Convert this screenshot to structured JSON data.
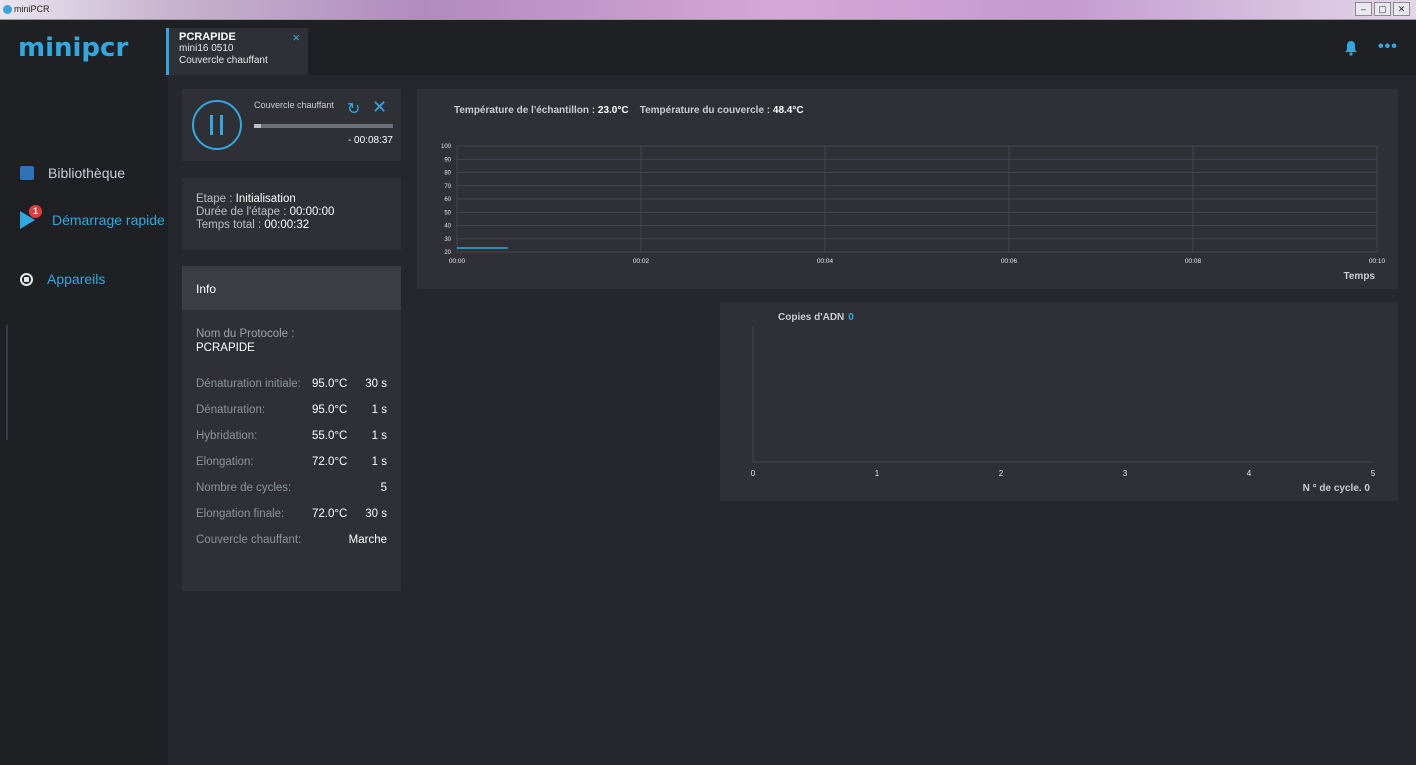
{
  "window": {
    "title": "miniPCR",
    "buttons": [
      "–",
      "▢",
      "✕"
    ]
  },
  "header": {
    "logo": "minipcr",
    "tab": {
      "name": "PCRAPIDE",
      "device": "mini16 0510",
      "status": "Couvercle chauffant",
      "close": "×"
    },
    "menu_dots": "•••"
  },
  "sidebar": {
    "items": [
      {
        "label": "Bibliothèque",
        "icon": "book-icon"
      },
      {
        "label": "Démarrage rapide",
        "icon": "play-icon",
        "badge": "1"
      },
      {
        "label": "Appareils",
        "icon": "device-icon"
      }
    ]
  },
  "run": {
    "label": "Couvercle chauffant",
    "refresh": "↻",
    "close": "✕",
    "remaining": "- 00:08:37",
    "progress": 0.05
  },
  "step": {
    "etape_label": "Etape : ",
    "etape_value": "Initialisation",
    "duree_label": "Durée de l'étape : ",
    "duree_value": "00:00:00",
    "total_label": "Temps total : ",
    "total_value": "00:00:32"
  },
  "info": {
    "header": "Info",
    "protocol_label": "Nom du Protocole :",
    "protocol_name": "PCRAPIDE",
    "rows": [
      {
        "key": "Dénaturation initiale:",
        "temp": "95.0°C",
        "time": "30 s"
      },
      {
        "key": "Dénaturation:",
        "temp": "95.0°C",
        "time": "1 s"
      },
      {
        "key": "Hybridation:",
        "temp": "55.0°C",
        "time": "1 s"
      },
      {
        "key": "Elongation:",
        "temp": "72.0°C",
        "time": "1 s"
      },
      {
        "key": "Nombre de cycles:",
        "temp": "",
        "time": "5"
      },
      {
        "key": "Elongation finale:",
        "temp": "72.0°C",
        "time": "30 s"
      },
      {
        "key": "Couvercle chauffant:",
        "temp": "",
        "time": "Marche"
      }
    ]
  },
  "temp_chart": {
    "sample_label": "Température de l'échantillon : ",
    "sample_value": "23.0°C",
    "lid_label": "Température du couvercle : ",
    "lid_value": "48.4°C",
    "line_color": "#2fa9e0"
  },
  "dna_chart": {
    "title": "Copies d'ADN",
    "value": "0"
  },
  "chart_data": [
    {
      "type": "line",
      "title": "",
      "xlabel": "Temps",
      "ylabel": "",
      "x_ticks": [
        "00:00",
        "00:02",
        "00:04",
        "00:06",
        "00:08",
        "00:10"
      ],
      "y_ticks": [
        "20",
        "30",
        "40",
        "50",
        "60",
        "70",
        "80",
        "90",
        "100"
      ],
      "xlim": [
        0,
        10
      ],
      "ylim": [
        20,
        100
      ],
      "series": [
        {
          "x": [
            0,
            0.55
          ],
          "values": [
            23,
            23
          ]
        }
      ]
    },
    {
      "type": "line",
      "title": "Copies d'ADN",
      "xlabel": "N ° de cycle. 0",
      "ylabel": "",
      "x_ticks": [
        "0",
        "1",
        "2",
        "3",
        "4",
        "5"
      ],
      "xlim": [
        0,
        5
      ],
      "series": []
    }
  ]
}
